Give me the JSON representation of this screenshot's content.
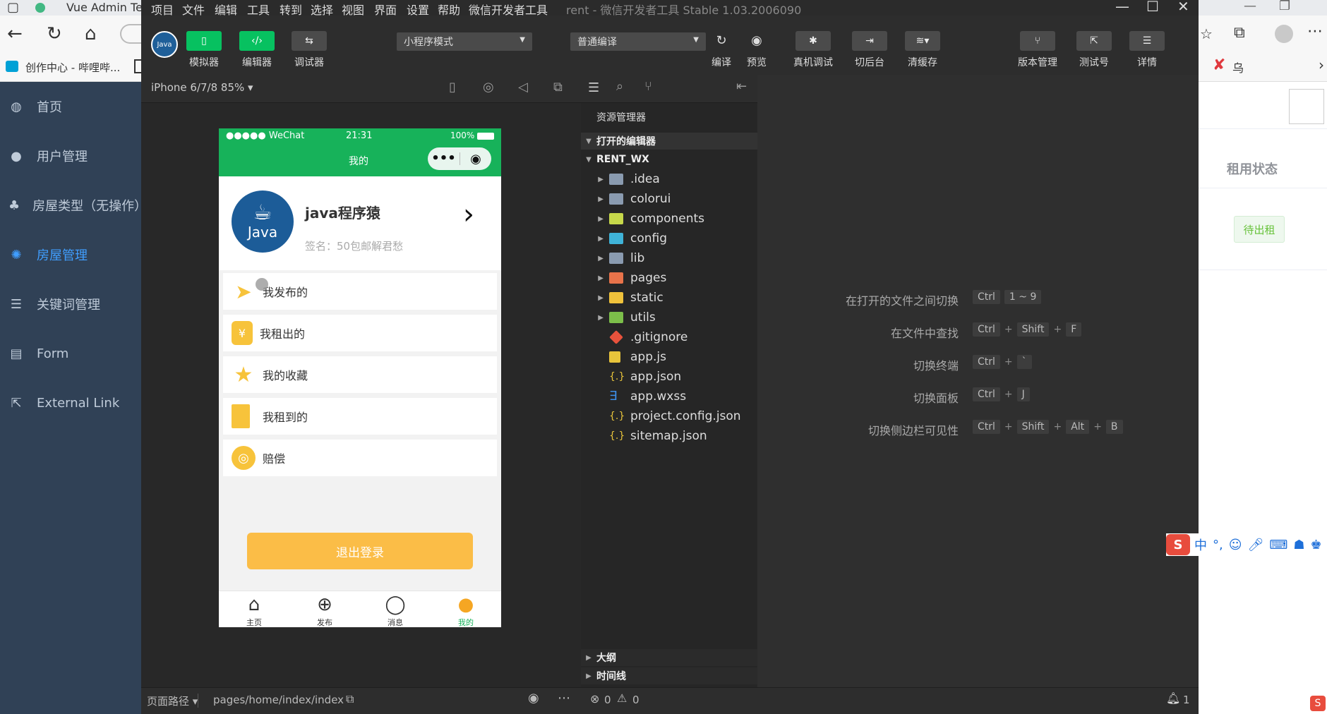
{
  "browser": {
    "tab_title": "Vue Admin Tem",
    "bookmark": "创作中心 - 哔哩哔...",
    "ime_label": "中"
  },
  "sidebar": {
    "items": [
      {
        "label": "首页",
        "icon": "dashboard-icon"
      },
      {
        "label": "用户管理",
        "icon": "user-icon"
      },
      {
        "label": "房屋类型（无操作）",
        "icon": "tree-icon"
      },
      {
        "label": "房屋管理",
        "icon": "house-icon",
        "active": true
      },
      {
        "label": "关键词管理",
        "icon": "list-icon"
      },
      {
        "label": "Form",
        "icon": "form-icon"
      },
      {
        "label": "External Link",
        "icon": "link-icon"
      }
    ]
  },
  "right_pane": {
    "column_header": "租用状态",
    "status_tag": "待出租"
  },
  "devtools": {
    "menu": [
      "项目",
      "文件",
      "编辑",
      "工具",
      "转到",
      "选择",
      "视图",
      "界面",
      "设置",
      "帮助",
      "微信开发者工具"
    ],
    "window_title": "rent - 微信开发者工具 Stable 1.03.2006090",
    "toolbar": {
      "simulator": "模拟器",
      "editor": "编辑器",
      "debugger": "调试器",
      "mode_select": "小程序模式",
      "compile_select": "普通编译",
      "compile": "编译",
      "preview": "预览",
      "real_debug": "真机调试",
      "backend": "切后台",
      "clear_cache": "清缓存",
      "version": "版本管理",
      "test_account": "测试号",
      "details": "详情"
    },
    "simulator": {
      "device": "iPhone 6/7/8 85% ▾",
      "page_path_label": "页面路径 ▾",
      "page_path": "pages/home/index/index",
      "errors": "0",
      "warnings": "0",
      "notifications": "1"
    },
    "phone": {
      "status_carrier": "●●●●● WeChat",
      "status_time": "21:31",
      "status_battery": "100%",
      "nav_title": "我的",
      "avatar_text": "Java",
      "username": "java程序猿",
      "signature": "签名：50包邮解君愁",
      "menu_items": [
        {
          "label": "我发布的",
          "icon": "paper-plane-icon",
          "color": "#f7c33b"
        },
        {
          "label": "我租出的",
          "icon": "coins-icon",
          "color": "#f7c33b"
        },
        {
          "label": "我的收藏",
          "icon": "star-icon",
          "color": "#f7c33b"
        },
        {
          "label": "我租到的",
          "icon": "door-icon",
          "color": "#f7c33b"
        },
        {
          "label": "赔偿",
          "icon": "coin-icon",
          "color": "#f7c33b"
        }
      ],
      "logout": "退出登录",
      "tabs": [
        {
          "label": "主页",
          "icon": "home-icon"
        },
        {
          "label": "发布",
          "icon": "plus-circle-icon"
        },
        {
          "label": "消息",
          "icon": "chat-icon"
        },
        {
          "label": "我的",
          "icon": "person-icon",
          "active": true
        }
      ]
    },
    "explorer": {
      "title": "资源管理器",
      "open_editors": "打开的编辑器",
      "project": "RENT_WX",
      "files": [
        {
          "name": ".idea",
          "type": "folder",
          "color": "#8a9bb0"
        },
        {
          "name": "colorui",
          "type": "folder",
          "color": "#8a9bb0"
        },
        {
          "name": "components",
          "type": "folder",
          "color": "#c6d84a"
        },
        {
          "name": "config",
          "type": "folder",
          "color": "#3fb3d8"
        },
        {
          "name": "lib",
          "type": "folder",
          "color": "#8a9bb0"
        },
        {
          "name": "pages",
          "type": "folder",
          "color": "#e8734a"
        },
        {
          "name": "static",
          "type": "folder",
          "color": "#f0c23b"
        },
        {
          "name": "utils",
          "type": "folder",
          "color": "#7cbf4a"
        },
        {
          "name": ".gitignore",
          "type": "file",
          "color": "#e8523c"
        },
        {
          "name": "app.js",
          "type": "file",
          "color": "#e8c43b"
        },
        {
          "name": "app.json",
          "type": "file",
          "color": "#e8c43b"
        },
        {
          "name": "app.wxss",
          "type": "file",
          "color": "#3d8fe8"
        },
        {
          "name": "project.config.json",
          "type": "file",
          "color": "#e8c43b"
        },
        {
          "name": "sitemap.json",
          "type": "file",
          "color": "#e8c43b"
        }
      ],
      "outline": "大纲",
      "timeline": "时间线"
    },
    "shortcuts": [
      {
        "label": "在打开的文件之间切换",
        "keys": [
          "Ctrl",
          "1 ~ 9"
        ]
      },
      {
        "label": "在文件中查找",
        "keys": [
          "Ctrl",
          "+",
          "Shift",
          "+",
          "F"
        ]
      },
      {
        "label": "切换终端",
        "keys": [
          "Ctrl",
          "+",
          "`"
        ]
      },
      {
        "label": "切换面板",
        "keys": [
          "Ctrl",
          "+",
          "J"
        ]
      },
      {
        "label": "切换侧边栏可见性",
        "keys": [
          "Ctrl",
          "+",
          "Shift",
          "+",
          "Alt",
          "+",
          "B"
        ]
      }
    ]
  }
}
